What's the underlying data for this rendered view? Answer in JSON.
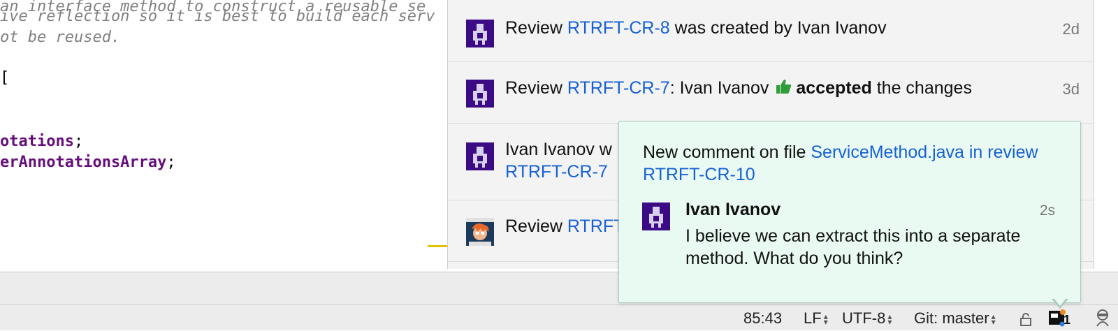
{
  "editor": {
    "lines": [
      {
        "text": "an interface method to construct a reusable se",
        "style": "comment"
      },
      {
        "text": "ive reflection so it is best to build each serv",
        "style": "comment"
      },
      {
        "text": "ot be reused.",
        "style": "comment"
      },
      {
        "text": "[",
        "style": "plain"
      },
      {
        "name_text": "otations",
        "punct": ";"
      },
      {
        "name_text": "erAnnotationsArray",
        "punct": ";"
      }
    ]
  },
  "events": [
    {
      "prefix": "Review ",
      "link": "RTRFT-CR-8",
      "suffix": " was created by Ivan Ivanov",
      "time": "2d"
    },
    {
      "prefix": "Review ",
      "link": "RTRFT-CR-7",
      "middle": ": Ivan Ivanov ",
      "bold": "accepted",
      "suffix": " the changes",
      "time": "3d"
    },
    {
      "prefix": "Ivan Ivanov w",
      "link": "RTRFT-CR-7",
      "time": ""
    },
    {
      "prefix": "Review ",
      "link": "RTRFT",
      "time": ""
    }
  ],
  "popup": {
    "title_prefix": "New comment on file ",
    "title_link": "ServiceMethod.java in review RTRFT-CR-10",
    "author": "Ivan Ivanov",
    "time": "2s",
    "body": "I believe we can extract this into a separate method. What do you think?"
  },
  "status": {
    "position": "85:43",
    "line_ending": "LF",
    "encoding": "UTF-8",
    "vcs": "Git: master",
    "notification_count": "1"
  },
  "icons": {
    "thumb": "thumbs-up-icon",
    "lock": "lock-icon",
    "upsource": "upsource-notification-icon",
    "inspector": "hector-inspector-icon"
  },
  "colors": {
    "link": "#1660d6",
    "popup_bg": "#e9faf2",
    "avatar_purple": "#3b0a85",
    "thumb_green": "#2f9e3a"
  }
}
